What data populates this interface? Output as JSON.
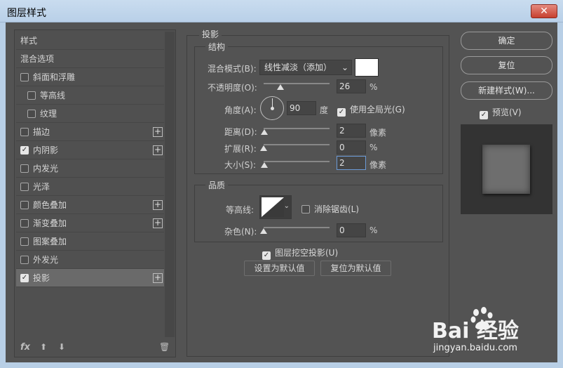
{
  "window": {
    "title": "图层样式",
    "close_glyph": "✕"
  },
  "styles": {
    "header": "样式",
    "blending": "混合选项",
    "items": [
      {
        "label": "斜面和浮雕",
        "checked": false,
        "sub": false,
        "plus": false
      },
      {
        "label": "等高线",
        "checked": false,
        "sub": true,
        "plus": false
      },
      {
        "label": "纹理",
        "checked": false,
        "sub": true,
        "plus": false
      },
      {
        "label": "描边",
        "checked": false,
        "sub": false,
        "plus": true
      },
      {
        "label": "内阴影",
        "checked": true,
        "sub": false,
        "plus": true
      },
      {
        "label": "内发光",
        "checked": false,
        "sub": false,
        "plus": false
      },
      {
        "label": "光泽",
        "checked": false,
        "sub": false,
        "plus": false
      },
      {
        "label": "颜色叠加",
        "checked": false,
        "sub": false,
        "plus": true
      },
      {
        "label": "渐变叠加",
        "checked": false,
        "sub": false,
        "plus": true
      },
      {
        "label": "图案叠加",
        "checked": false,
        "sub": false,
        "plus": false
      },
      {
        "label": "外发光",
        "checked": false,
        "sub": false,
        "plus": false
      },
      {
        "label": "投影",
        "checked": true,
        "sub": false,
        "plus": true,
        "selected": true
      }
    ],
    "fx_label": "fx",
    "up_glyph": "⬆",
    "down_glyph": "⬇",
    "trash_glyph": "🗑"
  },
  "drop_shadow": {
    "title": "投影",
    "structure": {
      "title": "结构",
      "blend_mode_label": "混合模式(B):",
      "blend_mode_value": "线性减淡（添加）",
      "blend_color": "#ffffff",
      "opacity_label": "不透明度(O):",
      "opacity_value": "26",
      "opacity_unit": "%",
      "opacity_level": 0.26,
      "angle_label": "角度(A):",
      "angle_value": "90",
      "angle_unit": "度",
      "global_light_label": "使用全局光(G)",
      "global_light_checked": true,
      "distance_label": "距离(D):",
      "distance_value": "2",
      "distance_unit": "像素",
      "spread_label": "扩展(R):",
      "spread_value": "0",
      "spread_unit": "%",
      "size_label": "大小(S):",
      "size_value": "2",
      "size_unit": "像素"
    },
    "quality": {
      "title": "品质",
      "contour_label": "等高线:",
      "antialias_label": "消除锯齿(L)",
      "antialias_checked": false,
      "noise_label": "杂色(N):",
      "noise_value": "0",
      "noise_unit": "%"
    },
    "knockout_label": "图层挖空投影(U)",
    "knockout_checked": true,
    "make_default_label": "设置为默认值",
    "reset_default_label": "复位为默认值"
  },
  "actions": {
    "ok_label": "确定",
    "reset_label": "复位",
    "new_style_label": "新建样式(W)...",
    "preview_label": "预览(V)",
    "preview_checked": true
  },
  "watermark": {
    "brand": "Bai 经验",
    "url": "jingyan.baidu.com"
  },
  "colors": {
    "panel_bg": "#535353",
    "selected_row": "#6a6a6a",
    "titlebar": "#c9dcef",
    "close_red": "#c7402f"
  }
}
